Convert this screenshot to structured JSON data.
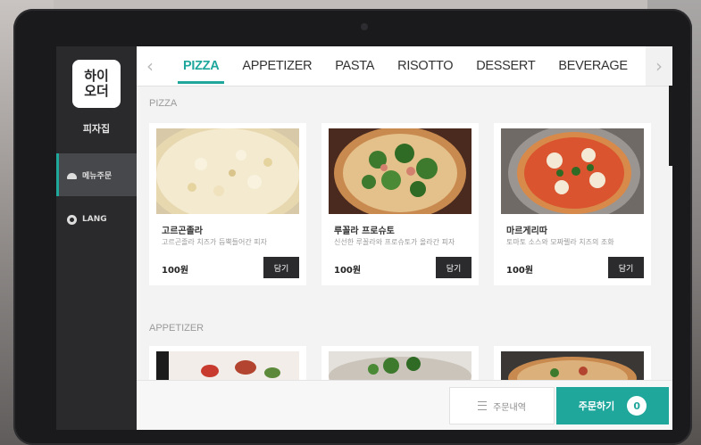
{
  "store": {
    "logo_line1": "하이",
    "logo_line2": "오더",
    "name": "피자집"
  },
  "sidebar": {
    "items": [
      {
        "label": "메뉴주문",
        "icon": "menu-icon",
        "active": true
      },
      {
        "label": "LANG",
        "icon": "globe-icon",
        "active": false
      }
    ]
  },
  "tabs": [
    "PIZZA",
    "APPETIZER",
    "PASTA",
    "RISOTTO",
    "DESSERT",
    "BEVERAGE"
  ],
  "active_tab": "PIZZA",
  "sections": [
    {
      "title": "PIZZA",
      "items": [
        {
          "name": "고르곤졸라",
          "desc": "고르곤졸라 치즈가 듬뿍들어간 피자",
          "price": "100원",
          "button": "담기"
        },
        {
          "name": "루꼴라 프로슈토",
          "desc": "신선한 루꼴라와 프로슈토가 올라간 피자",
          "price": "100원",
          "button": "담기"
        },
        {
          "name": "마르게리따",
          "desc": "토마토 소스와 모짜렐라 치즈의 조화",
          "price": "100원",
          "button": "담기"
        }
      ]
    },
    {
      "title": "APPETIZER",
      "items": []
    }
  ],
  "bottom": {
    "history_label": "주문내역",
    "order_label": "주문하기",
    "cart_count": "0"
  },
  "colors": {
    "accent": "#1fa79c",
    "sidebar_bg": "#2a2a2c",
    "button_dark": "#2b2b2d"
  }
}
